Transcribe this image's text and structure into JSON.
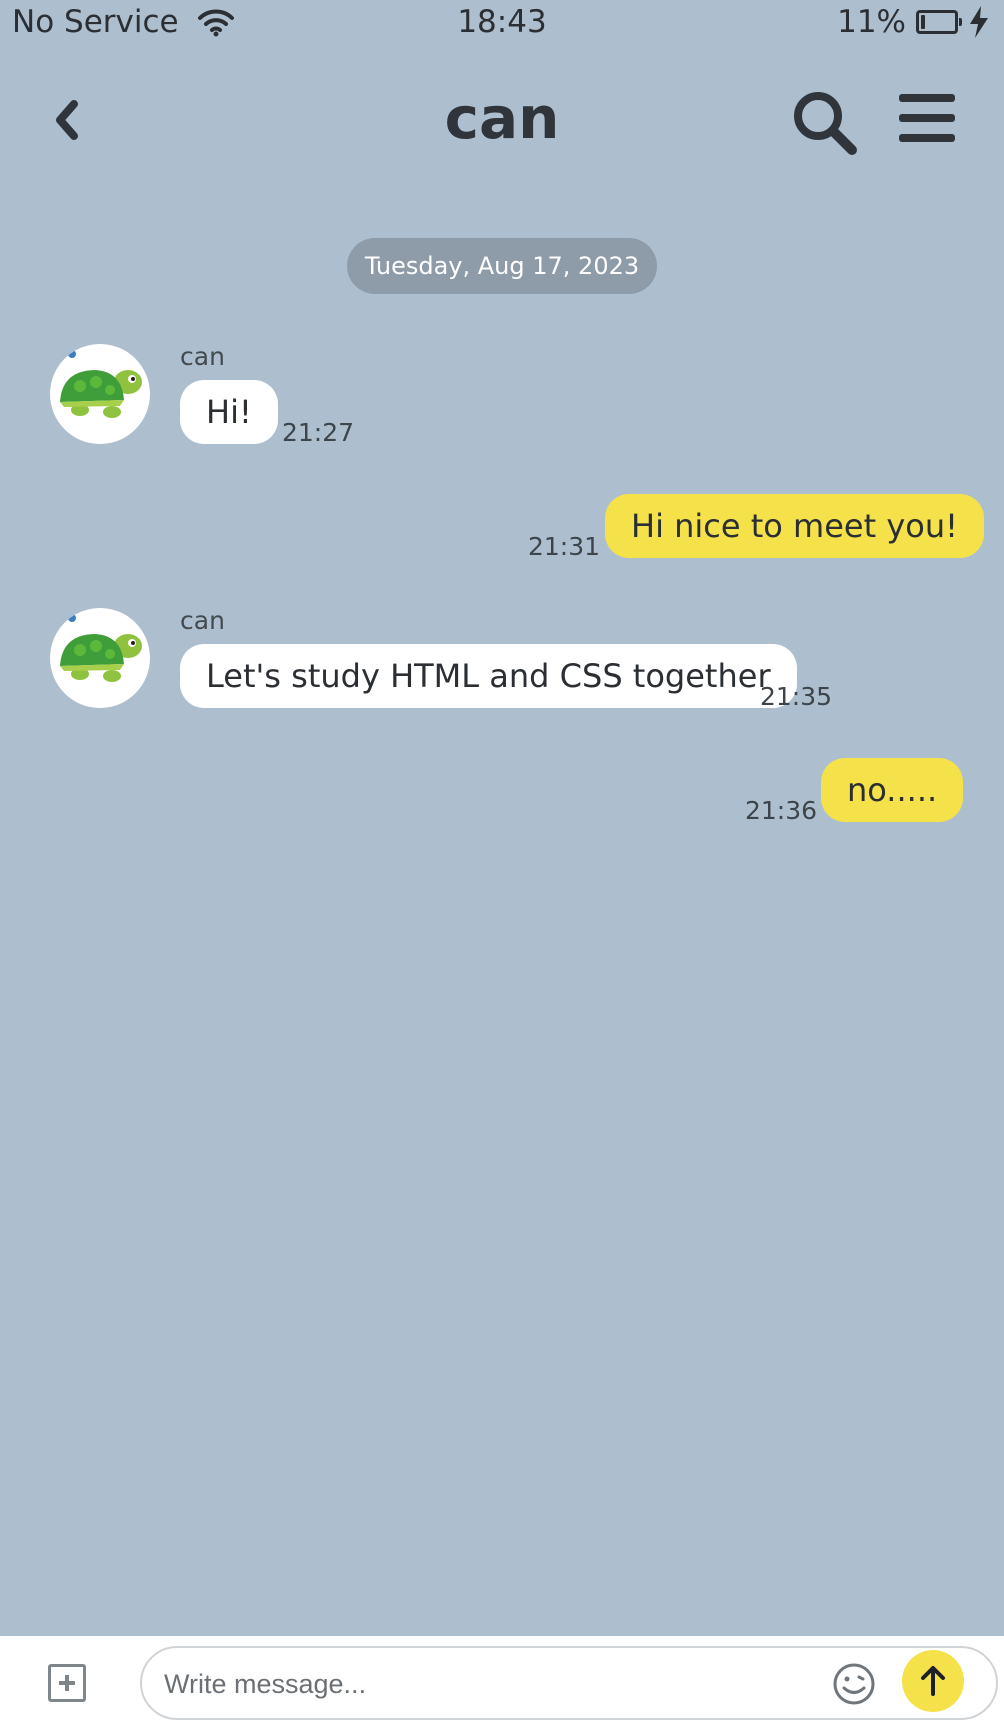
{
  "status_bar": {
    "carrier": "No Service",
    "time": "18:43",
    "battery": "11%",
    "battery_level": 0.11
  },
  "header": {
    "title": "can"
  },
  "date_separator": "Tuesday, Aug 17, 2023",
  "messages": [
    {
      "direction": "incoming",
      "sender": "can",
      "text": "Hi!",
      "time": "21:27"
    },
    {
      "direction": "outgoing",
      "text": "Hi nice to meet you!",
      "time": "21:31"
    },
    {
      "direction": "incoming",
      "sender": "can",
      "text": "Let's study HTML and CSS together",
      "time": "21:35"
    },
    {
      "direction": "outgoing",
      "text": "no.....",
      "time": "21:36"
    }
  ],
  "composer": {
    "placeholder": "Write message..."
  },
  "icons": {
    "back": "chevron-left-icon",
    "search": "search-icon",
    "menu": "hamburger-menu-icon",
    "add": "plus-square-icon",
    "emoji": "smiley-icon",
    "send": "arrow-up-icon",
    "wifi": "wifi-icon",
    "battery": "battery-icon",
    "charging": "lightning-icon",
    "avatar": "turtle-avatar"
  },
  "colors": {
    "background": "#adbfcf",
    "outgoing_bubble": "#f5e24a",
    "incoming_bubble": "#ffffff",
    "date_pill": "#8e9ba8"
  }
}
